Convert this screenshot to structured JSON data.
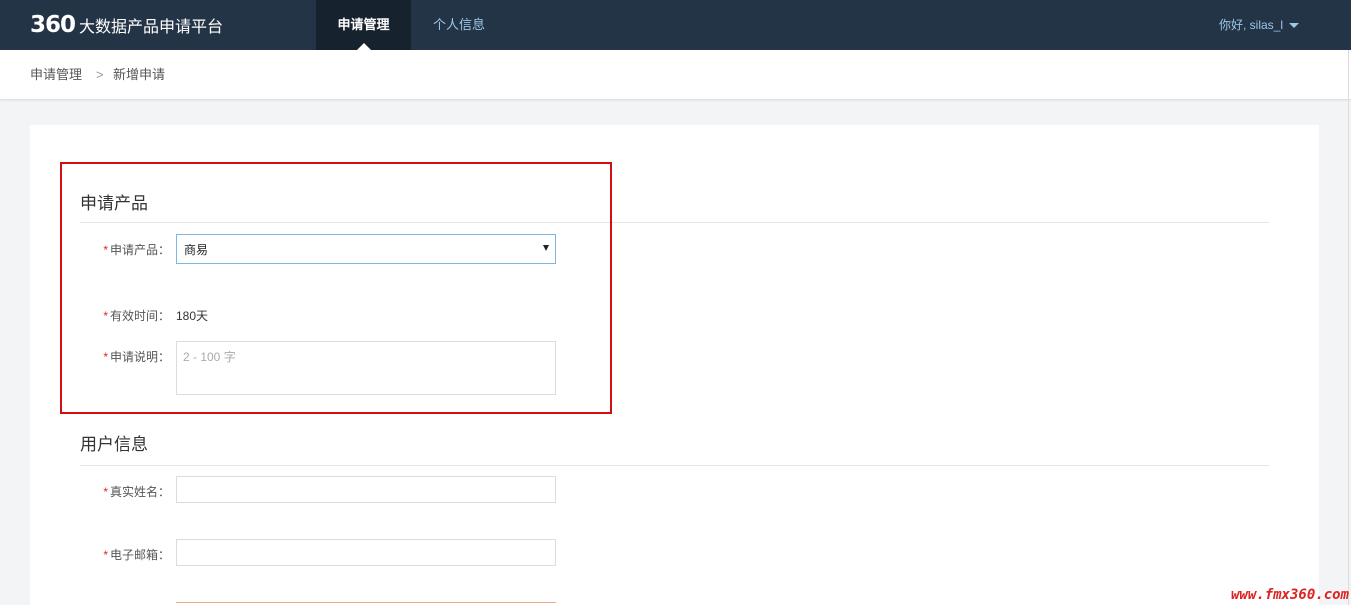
{
  "header": {
    "logo_mark": "360",
    "logo_text": "大数据产品申请平台",
    "tabs": [
      {
        "label": "申请管理",
        "active": true
      },
      {
        "label": "个人信息",
        "active": false
      }
    ],
    "user_greeting": "你好, silas_l"
  },
  "breadcrumb": {
    "items": [
      "申请管理",
      "新增申请"
    ],
    "separator": ">"
  },
  "sections": {
    "product": {
      "title": "申请产品",
      "fields": {
        "product": {
          "label": "申请产品：",
          "value": "商易"
        },
        "valid_time": {
          "label": "有效时间：",
          "value": "180天"
        },
        "description": {
          "label": "申请说明：",
          "placeholder": "2 - 100 字"
        }
      }
    },
    "user": {
      "title": "用户信息",
      "fields": {
        "real_name": {
          "label": "真实姓名："
        },
        "email": {
          "label": "电子邮箱："
        }
      }
    }
  },
  "required_mark": "*",
  "watermark": "www.fmx360.com",
  "colors": {
    "topbar": "#243447",
    "active_tab": "#17222f",
    "nav_link": "#9ec6e6",
    "highlight": "#d20f0f",
    "required": "#e02424"
  }
}
